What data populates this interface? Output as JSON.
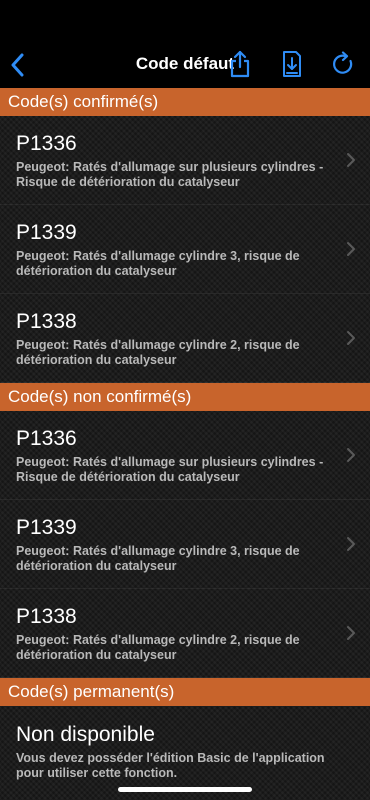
{
  "nav": {
    "title": "Code défaut",
    "back_icon": "chevron-left-icon",
    "share_icon": "share-icon",
    "save_icon": "download-icon",
    "refresh_icon": "refresh-icon",
    "accent": "#2f8cf5"
  },
  "colors": {
    "section_header": "#c8642c",
    "background": "#1c1c1c"
  },
  "sections": [
    {
      "title": "Code(s) confirmé(s)",
      "items": [
        {
          "code": "P1336",
          "desc": "Peugeot: Ratés d'allumage sur plusieurs cylindres - Risque de détérioration du catalyseur"
        },
        {
          "code": "P1339",
          "desc": "Peugeot: Ratés d'allumage cylindre 3, risque de détérioration du catalyseur"
        },
        {
          "code": "P1338",
          "desc": "Peugeot: Ratés d'allumage cylindre 2, risque de détérioration du catalyseur"
        }
      ]
    },
    {
      "title": "Code(s) non confirmé(s)",
      "items": [
        {
          "code": "P1336",
          "desc": "Peugeot: Ratés d'allumage sur plusieurs cylindres - Risque de détérioration du catalyseur"
        },
        {
          "code": "P1339",
          "desc": "Peugeot: Ratés d'allumage cylindre 3, risque de détérioration du catalyseur"
        },
        {
          "code": "P1338",
          "desc": "Peugeot: Ratés d'allumage cylindre 2, risque de détérioration du catalyseur"
        }
      ]
    },
    {
      "title": "Code(s) permanent(s)",
      "items": [
        {
          "code": "Non disponible",
          "desc": "Vous devez posséder l'édition Basic de l'application pour utiliser cette fonction."
        }
      ]
    }
  ]
}
